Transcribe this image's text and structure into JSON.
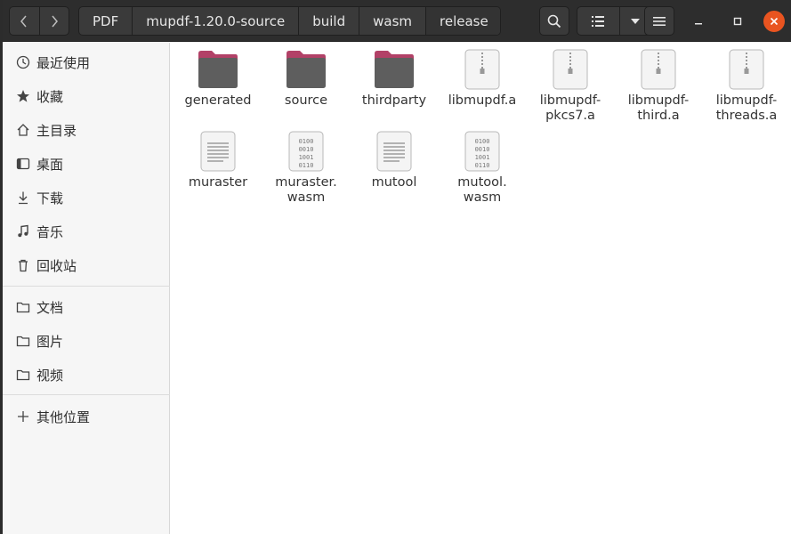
{
  "breadcrumbs": [
    "PDF",
    "mupdf-1.20.0-source",
    "build",
    "wasm",
    "release"
  ],
  "sidebar": {
    "group1": [
      {
        "label": "最近使用",
        "icon": "recent-icon"
      },
      {
        "label": "收藏",
        "icon": "star-icon"
      },
      {
        "label": "主目录",
        "icon": "home-icon"
      },
      {
        "label": "桌面",
        "icon": "desktop-icon"
      },
      {
        "label": "下载",
        "icon": "download-icon"
      },
      {
        "label": "音乐",
        "icon": "music-icon"
      },
      {
        "label": "回收站",
        "icon": "trash-icon"
      }
    ],
    "group2": [
      {
        "label": "文档",
        "icon": "folder-icon"
      },
      {
        "label": "图片",
        "icon": "folder-icon"
      },
      {
        "label": "视频",
        "icon": "folder-icon"
      }
    ],
    "other": {
      "label": "其他位置",
      "icon": "plus-icon"
    }
  },
  "files": [
    {
      "name": "generated",
      "kind": "folder"
    },
    {
      "name": "source",
      "kind": "folder"
    },
    {
      "name": "thirdparty",
      "kind": "folder"
    },
    {
      "name": "libmupdf.a",
      "kind": "archive"
    },
    {
      "name": "libmupdf-\npkcs7.a",
      "kind": "archive"
    },
    {
      "name": "libmupdf-\nthird.a",
      "kind": "archive"
    },
    {
      "name": "libmupdf-\nthreads.a",
      "kind": "archive"
    },
    {
      "name": "muraster",
      "kind": "text"
    },
    {
      "name": "muraster.\nwasm",
      "kind": "binary"
    },
    {
      "name": "mutool",
      "kind": "text"
    },
    {
      "name": "mutool.\nwasm",
      "kind": "binary"
    }
  ],
  "colors": {
    "accent": "#e95420",
    "folder_tab": "#b24167",
    "folder_body": "#5e5e5e"
  }
}
